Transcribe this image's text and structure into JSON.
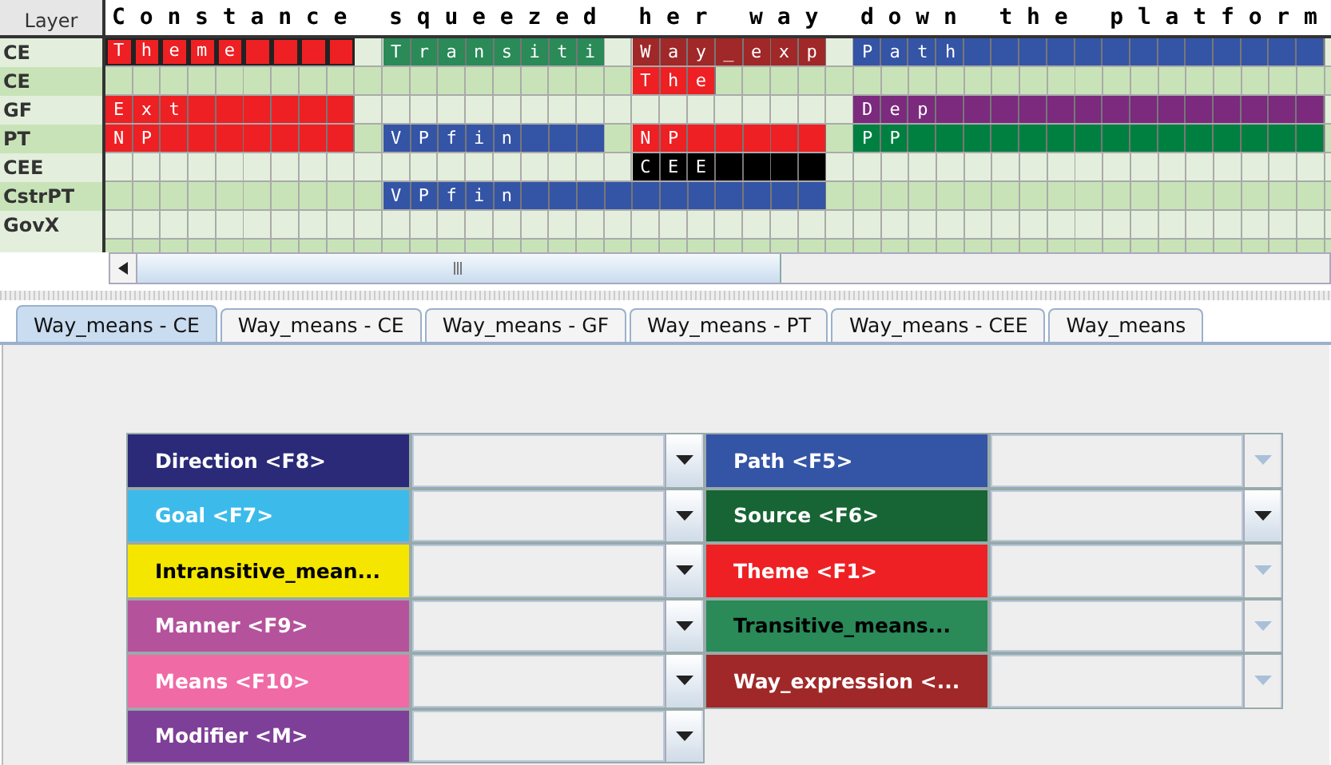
{
  "grid": {
    "corner_label": "Layer",
    "words": [
      "C o n s t a n c e",
      "s q u e e z e d",
      "h e r",
      "w a y",
      "d o w n",
      "t h e",
      "p l a t f o r m"
    ],
    "rows": [
      {
        "label": "CE",
        "segments": [
          {
            "kind": "start",
            "text": "T h e m e",
            "color": "#ee2024",
            "selected": true
          },
          {
            "kind": "start",
            "text": "T r a n s i t i",
            "color": "#2a8a58",
            "selected": false
          },
          {
            "kind": "start",
            "text": "W a y _ e x p",
            "color": "#a02828",
            "selected": false
          },
          {
            "kind": "continue"
          },
          {
            "kind": "start",
            "text": "P a t h",
            "color": "#3454a6",
            "selected": false
          },
          {
            "kind": "continue"
          },
          {
            "kind": "continue"
          }
        ]
      },
      {
        "label": "CE",
        "segments": [
          {
            "kind": "empty"
          },
          {
            "kind": "empty"
          },
          {
            "kind": "start",
            "text": "T h e",
            "color": "#ee2024",
            "selected": false
          },
          {
            "kind": "empty"
          },
          {
            "kind": "empty"
          },
          {
            "kind": "empty"
          },
          {
            "kind": "empty"
          }
        ]
      },
      {
        "label": "GF",
        "segments": [
          {
            "kind": "start",
            "text": "E x t",
            "color": "#ee2024",
            "selected": false
          },
          {
            "kind": "empty"
          },
          {
            "kind": "empty"
          },
          {
            "kind": "empty"
          },
          {
            "kind": "start",
            "text": "D e p",
            "color": "#7b2a7e",
            "selected": false
          },
          {
            "kind": "continue"
          },
          {
            "kind": "continue"
          }
        ]
      },
      {
        "label": "PT",
        "segments": [
          {
            "kind": "start",
            "text": "N P",
            "color": "#ee2024",
            "selected": false
          },
          {
            "kind": "start",
            "text": "V P f i n",
            "color": "#3454a6",
            "selected": false
          },
          {
            "kind": "start",
            "text": "N P",
            "color": "#ee2024",
            "selected": false
          },
          {
            "kind": "continue"
          },
          {
            "kind": "start",
            "text": "P P",
            "color": "#008040",
            "selected": false
          },
          {
            "kind": "continue"
          },
          {
            "kind": "continue"
          }
        ]
      },
      {
        "label": "CEE",
        "segments": [
          {
            "kind": "empty"
          },
          {
            "kind": "empty"
          },
          {
            "kind": "start",
            "text": "C E E",
            "color": "#000000",
            "selected": false
          },
          {
            "kind": "continue"
          },
          {
            "kind": "empty"
          },
          {
            "kind": "empty"
          },
          {
            "kind": "empty"
          }
        ]
      },
      {
        "label": "CstrPT",
        "segments": [
          {
            "kind": "empty"
          },
          {
            "kind": "start",
            "text": "V P f i n",
            "color": "#3454a6",
            "selected": false
          },
          {
            "kind": "continue"
          },
          {
            "kind": "continue"
          },
          {
            "kind": "empty"
          },
          {
            "kind": "empty"
          },
          {
            "kind": "empty"
          }
        ]
      },
      {
        "label": "GovX",
        "segments": [
          {
            "kind": "empty"
          },
          {
            "kind": "empty"
          },
          {
            "kind": "empty"
          },
          {
            "kind": "empty"
          },
          {
            "kind": "empty"
          },
          {
            "kind": "empty"
          },
          {
            "kind": "empty"
          }
        ]
      }
    ]
  },
  "tabs": [
    {
      "label": "Way_means - CE",
      "selected": true
    },
    {
      "label": "Way_means - CE",
      "selected": false
    },
    {
      "label": "Way_means - GF",
      "selected": false
    },
    {
      "label": "Way_means - PT",
      "selected": false
    },
    {
      "label": "Way_means - CEE",
      "selected": false
    },
    {
      "label": "Way_means",
      "selected": false
    }
  ],
  "roles": [
    {
      "label": "Direction <F8>",
      "color": "#2a2a78",
      "dark_text": false,
      "enabled": true
    },
    {
      "label": "Path <F5>",
      "color": "#3454a6",
      "dark_text": false,
      "enabled": false
    },
    {
      "label": "Goal <F7>",
      "color": "#3cbbea",
      "dark_text": false,
      "enabled": true
    },
    {
      "label": "Source <F6>",
      "color": "#176434",
      "dark_text": false,
      "enabled": true
    },
    {
      "label": "Intransitive_mean...",
      "color": "#f5e600",
      "dark_text": true,
      "enabled": true
    },
    {
      "label": "Theme <F1>",
      "color": "#ee2024",
      "dark_text": false,
      "enabled": false
    },
    {
      "label": "Manner <F9>",
      "color": "#b5529c",
      "dark_text": false,
      "enabled": true
    },
    {
      "label": "Transitive_means...",
      "color": "#2a8a58",
      "dark_text": true,
      "enabled": false
    },
    {
      "label": "Means <F10>",
      "color": "#f06aa6",
      "dark_text": false,
      "enabled": true
    },
    {
      "label": "Way_expression <...",
      "color": "#a02828",
      "dark_text": false,
      "enabled": false
    },
    {
      "label": "Modifier <M>",
      "color": "#7e3f98",
      "dark_text": false,
      "enabled": true
    }
  ]
}
